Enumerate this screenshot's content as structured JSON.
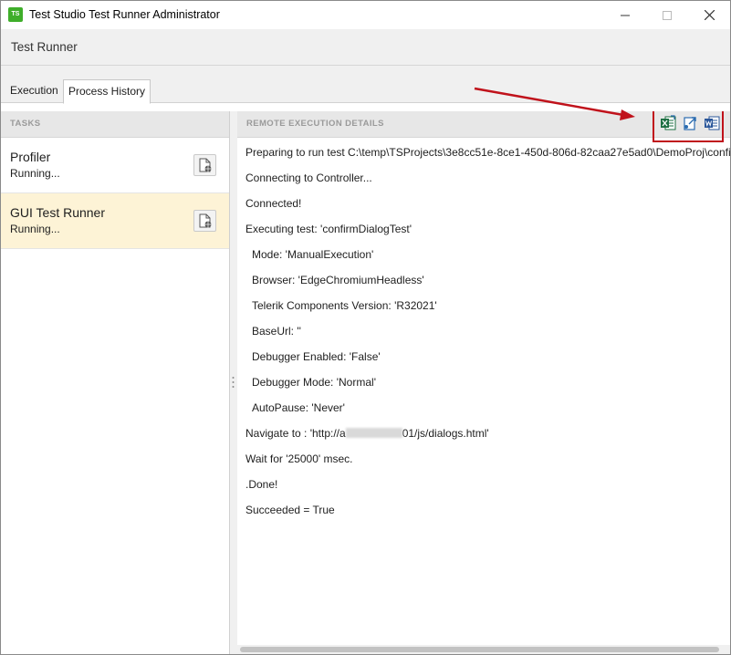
{
  "window": {
    "title": "Test Studio Test Runner Administrator",
    "logo_text": "TS",
    "controls": [
      "minimize",
      "maximize",
      "close"
    ]
  },
  "app": {
    "title": "Test Runner"
  },
  "tabs": [
    {
      "label": "Execution",
      "selected": false
    },
    {
      "label": "Process History",
      "selected": true
    }
  ],
  "tasks_panel": {
    "header": "TASKS",
    "items": [
      {
        "name": "Profiler",
        "status": "Running...",
        "selected": false
      },
      {
        "name": "GUI Test Runner",
        "status": "Running...",
        "selected": true
      }
    ]
  },
  "details_panel": {
    "header": "REMOTE EXECUTION DETAILS",
    "toolbar": [
      {
        "icon": "excel-export-icon",
        "color": "#1d6f42"
      },
      {
        "icon": "export-icon",
        "color": "#2b6cb0"
      },
      {
        "icon": "word-export-icon",
        "color": "#2b579a"
      }
    ],
    "log": [
      "Preparing to run test C:\\temp\\TSProjects\\3e8cc51e-8ce1-450d-806d-82caa27e5ad0\\DemoProj\\confirmDialogTest.tstest",
      "Connecting to Controller...",
      "Connected!",
      "Executing test: 'confirmDialogTest'",
      "Mode: 'ManualExecution'",
      "Browser: 'EdgeChromiumHeadless'",
      "Telerik Components Version: 'R32021'",
      "BaseUrl: ''",
      "Debugger Enabled: 'False'",
      "Debugger Mode: 'Normal'",
      "AutoPause: 'Never'",
      "Wait for '25000' msec.",
      ".Done!",
      "Succeeded = True"
    ],
    "navigate": {
      "prefix": "Navigate to : 'http://a",
      "suffix": "01/js/dialogs.html'"
    }
  },
  "colors": {
    "highlight_box": "#c0121b",
    "arrow": "#c0121b",
    "selected_task": "#fdf3d6",
    "accent": "#3fae2a"
  }
}
